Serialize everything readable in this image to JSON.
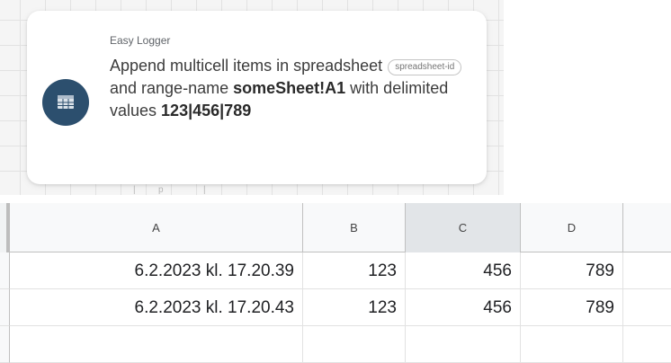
{
  "notification": {
    "app_name": "Easy Logger",
    "icon": "spreadsheet-icon",
    "message_part1": "Append multicell items in spreadsheet",
    "chip_label": "spreadsheet-id",
    "message_part2": "and range-name",
    "range_name": "someSheet!A1",
    "message_part3": "with delimited values",
    "values": "123|456|789"
  },
  "background": {
    "strip_mark": "p"
  },
  "sheet": {
    "columns": [
      "A",
      "B",
      "C",
      "D"
    ],
    "selected_column": "C",
    "rows": [
      [
        "6.2.2023 kl. 17.20.39",
        "123",
        "456",
        "789"
      ],
      [
        "6.2.2023 kl. 17.20.43",
        "123",
        "456",
        "789"
      ],
      [
        "",
        "",
        "",
        ""
      ]
    ]
  },
  "colors": {
    "icon_background": "#2c4f6e",
    "selected_header": "#e2e5e8"
  }
}
